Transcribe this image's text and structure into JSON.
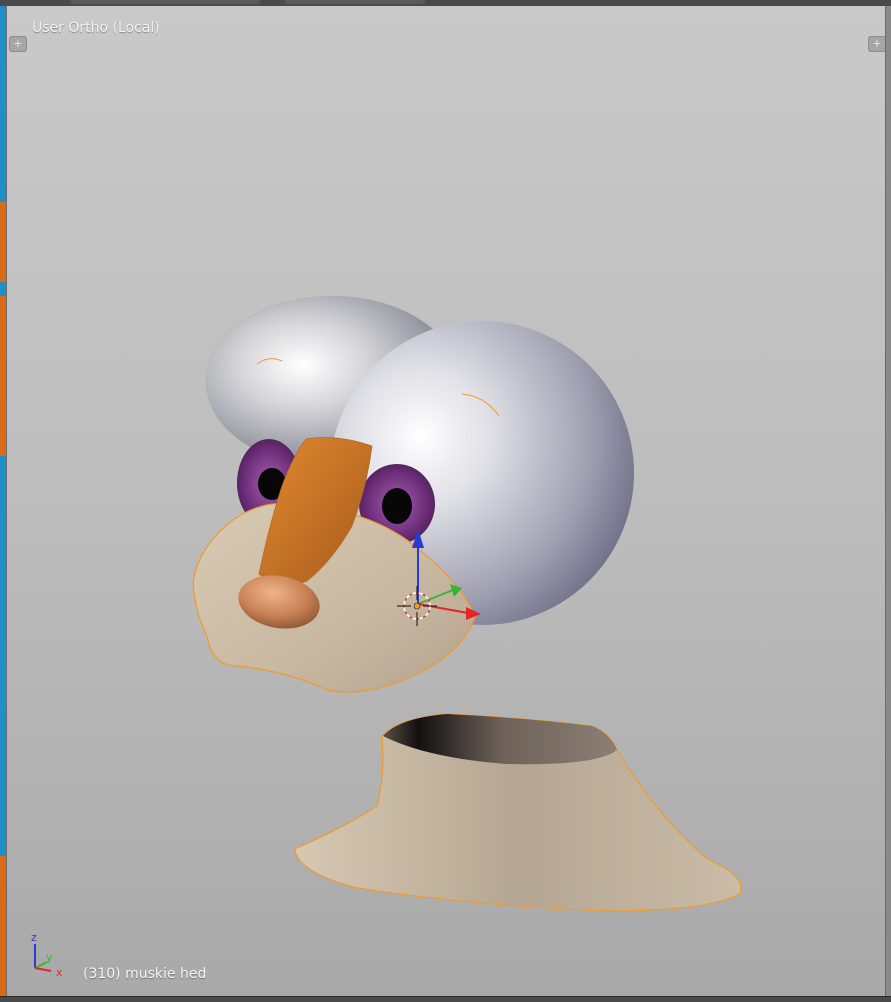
{
  "viewport": {
    "view_label": "User Ortho (Local)",
    "object_label": "(310) muskie hed"
  },
  "gizmo": {
    "x_label": "x",
    "y_label": "y",
    "z_label": "z"
  },
  "icons": {
    "region_toggle_left": "plus-icon",
    "region_toggle_right": "plus-icon",
    "region_toggle_glyph": "+"
  },
  "colors": {
    "selection_outline": "#f09a2a",
    "axis_x": "#e3262a",
    "axis_y": "#35b634",
    "axis_z": "#2a3ad6",
    "skin": "#cdbda7",
    "beak": "#d07a26",
    "iris": "#6e2e7a"
  }
}
